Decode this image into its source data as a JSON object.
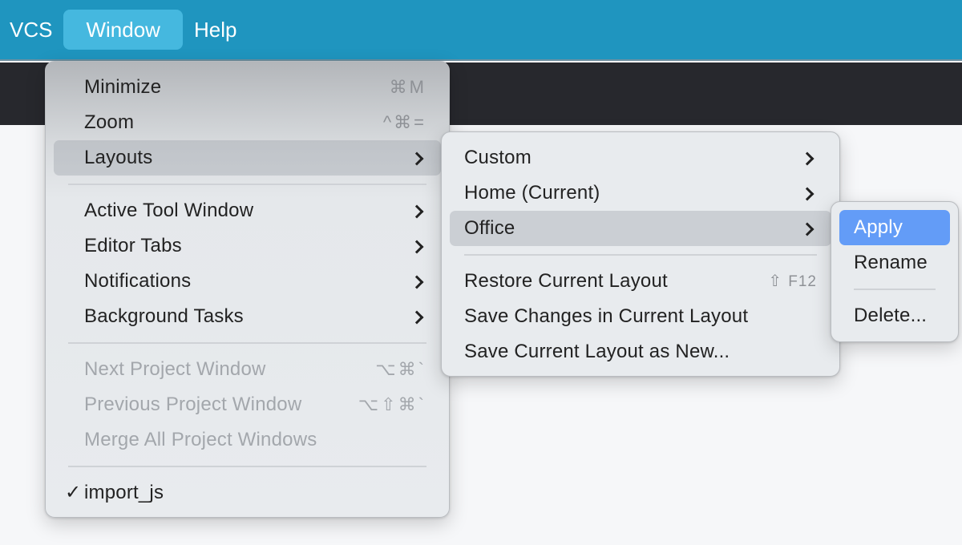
{
  "menubar": {
    "items": [
      {
        "label": "VCS"
      },
      {
        "label": "Window",
        "active": true
      },
      {
        "label": "Help"
      }
    ]
  },
  "window_menu": {
    "items": [
      {
        "label": "Minimize",
        "shortcut": "⌘M"
      },
      {
        "label": "Zoom",
        "shortcut": "^⌘="
      },
      {
        "label": "Layouts",
        "submenu": true,
        "highlighted": true
      },
      {
        "label": "Active Tool Window",
        "submenu": true
      },
      {
        "label": "Editor Tabs",
        "submenu": true
      },
      {
        "label": "Notifications",
        "submenu": true
      },
      {
        "label": "Background Tasks",
        "submenu": true
      },
      {
        "label": "Next Project Window",
        "shortcut": "⌥⌘`",
        "disabled": true
      },
      {
        "label": "Previous Project Window",
        "shortcut": "⌥⇧⌘`",
        "disabled": true
      },
      {
        "label": "Merge All Project Windows",
        "disabled": true
      },
      {
        "label": "import_js",
        "checked": true,
        "check_glyph": "✓"
      }
    ]
  },
  "layouts_menu": {
    "items": [
      {
        "label": "Custom",
        "submenu": true
      },
      {
        "label": "Home (Current)",
        "submenu": true
      },
      {
        "label": "Office",
        "submenu": true,
        "highlighted": true
      },
      {
        "label": "Restore Current Layout",
        "shortcut_icon": "⇧",
        "shortcut": "F12"
      },
      {
        "label": "Save Changes in Current Layout"
      },
      {
        "label": "Save Current Layout as New..."
      }
    ]
  },
  "office_menu": {
    "items": [
      {
        "label": "Apply",
        "selected": true
      },
      {
        "label": "Rename"
      },
      {
        "label": "Delete..."
      }
    ]
  },
  "colors": {
    "menubar": "#1f95bf",
    "menubar_active": "#45b8df",
    "selection": "#639cf7",
    "toolbar_dark": "#27282d"
  }
}
